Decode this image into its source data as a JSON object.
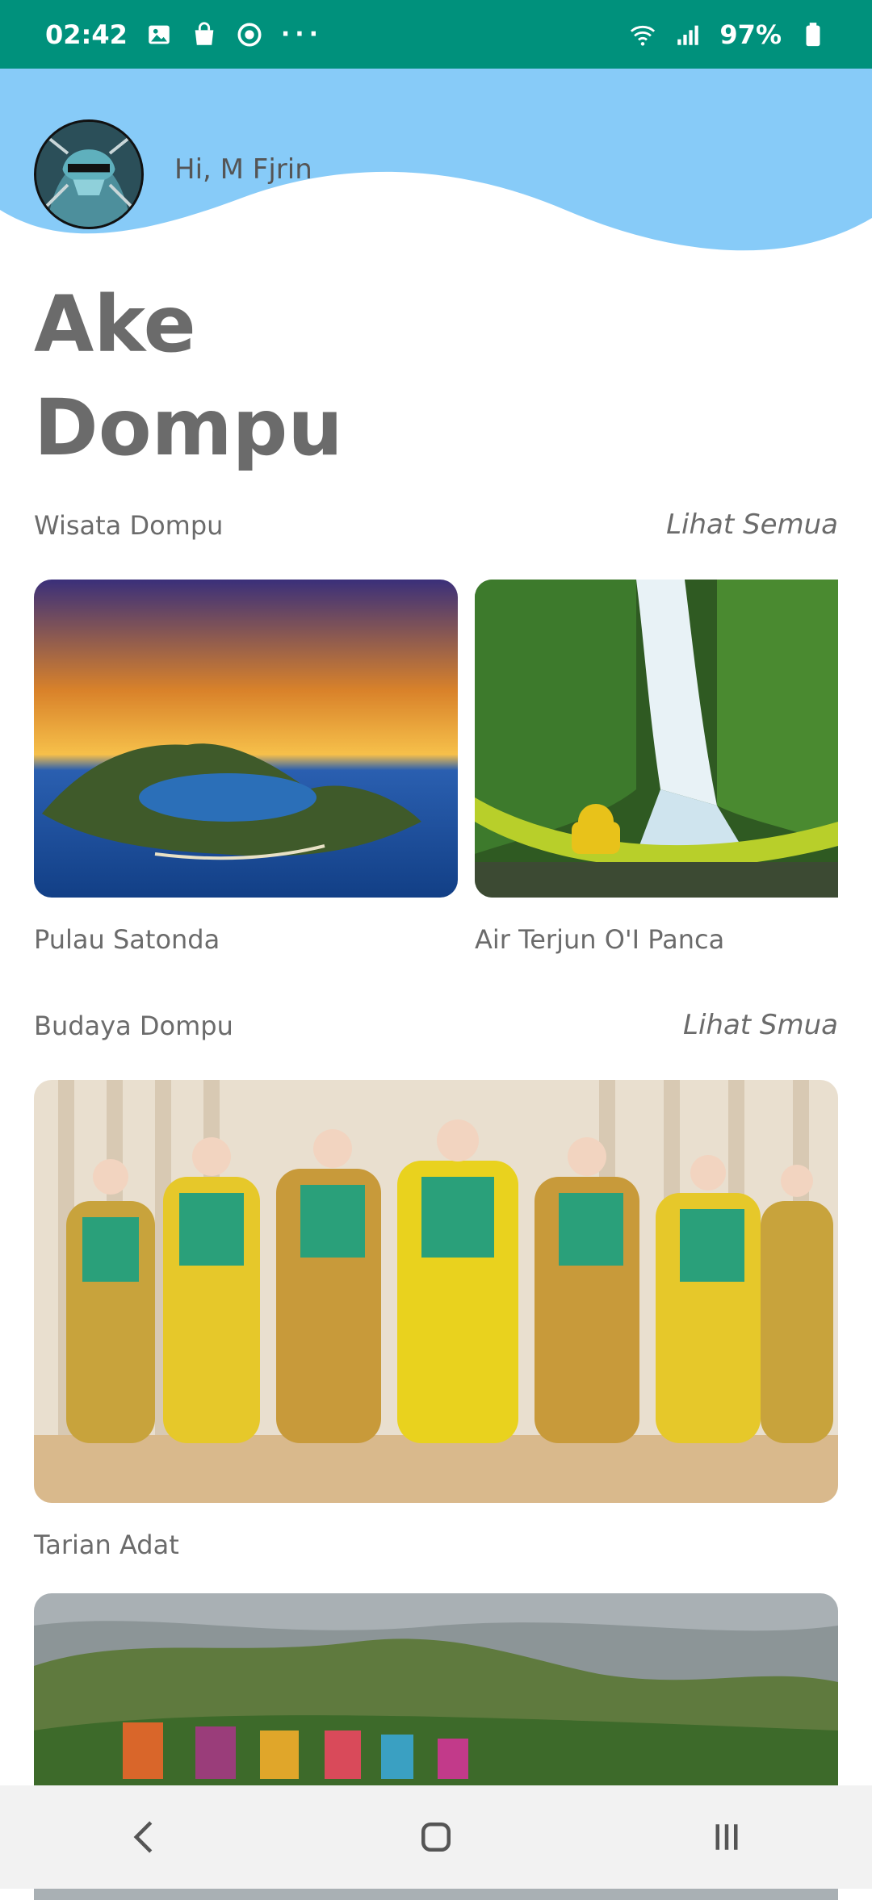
{
  "status_bar": {
    "time": "02:42",
    "battery": "97%",
    "more": "···",
    "icons": [
      "gallery-icon",
      "bag-icon",
      "sync-icon",
      "wifi-icon",
      "signal-icon",
      "battery-icon"
    ]
  },
  "header": {
    "greeting": "Hi, M Fjrin",
    "wave_color": "#87cbf8"
  },
  "title": {
    "line1": "Ake",
    "line2": "Dompu"
  },
  "sections": [
    {
      "label": "Wisata Dompu",
      "see_all": "Lihat Semua",
      "cards": [
        {
          "caption": "Pulau Satonda"
        },
        {
          "caption": "Air Terjun O'I Panca"
        }
      ]
    },
    {
      "label": "Budaya Dompu",
      "see_all": "Lihat Smua",
      "cards": [
        {
          "caption": "Tarian Adat"
        }
      ]
    }
  ],
  "colors": {
    "status_bar": "#00917c",
    "text": "#6b6b6b",
    "nav_bar": "#f2f2f2"
  },
  "navigation": {
    "icons": [
      "back-icon",
      "home-icon",
      "recent-apps-icon"
    ]
  }
}
